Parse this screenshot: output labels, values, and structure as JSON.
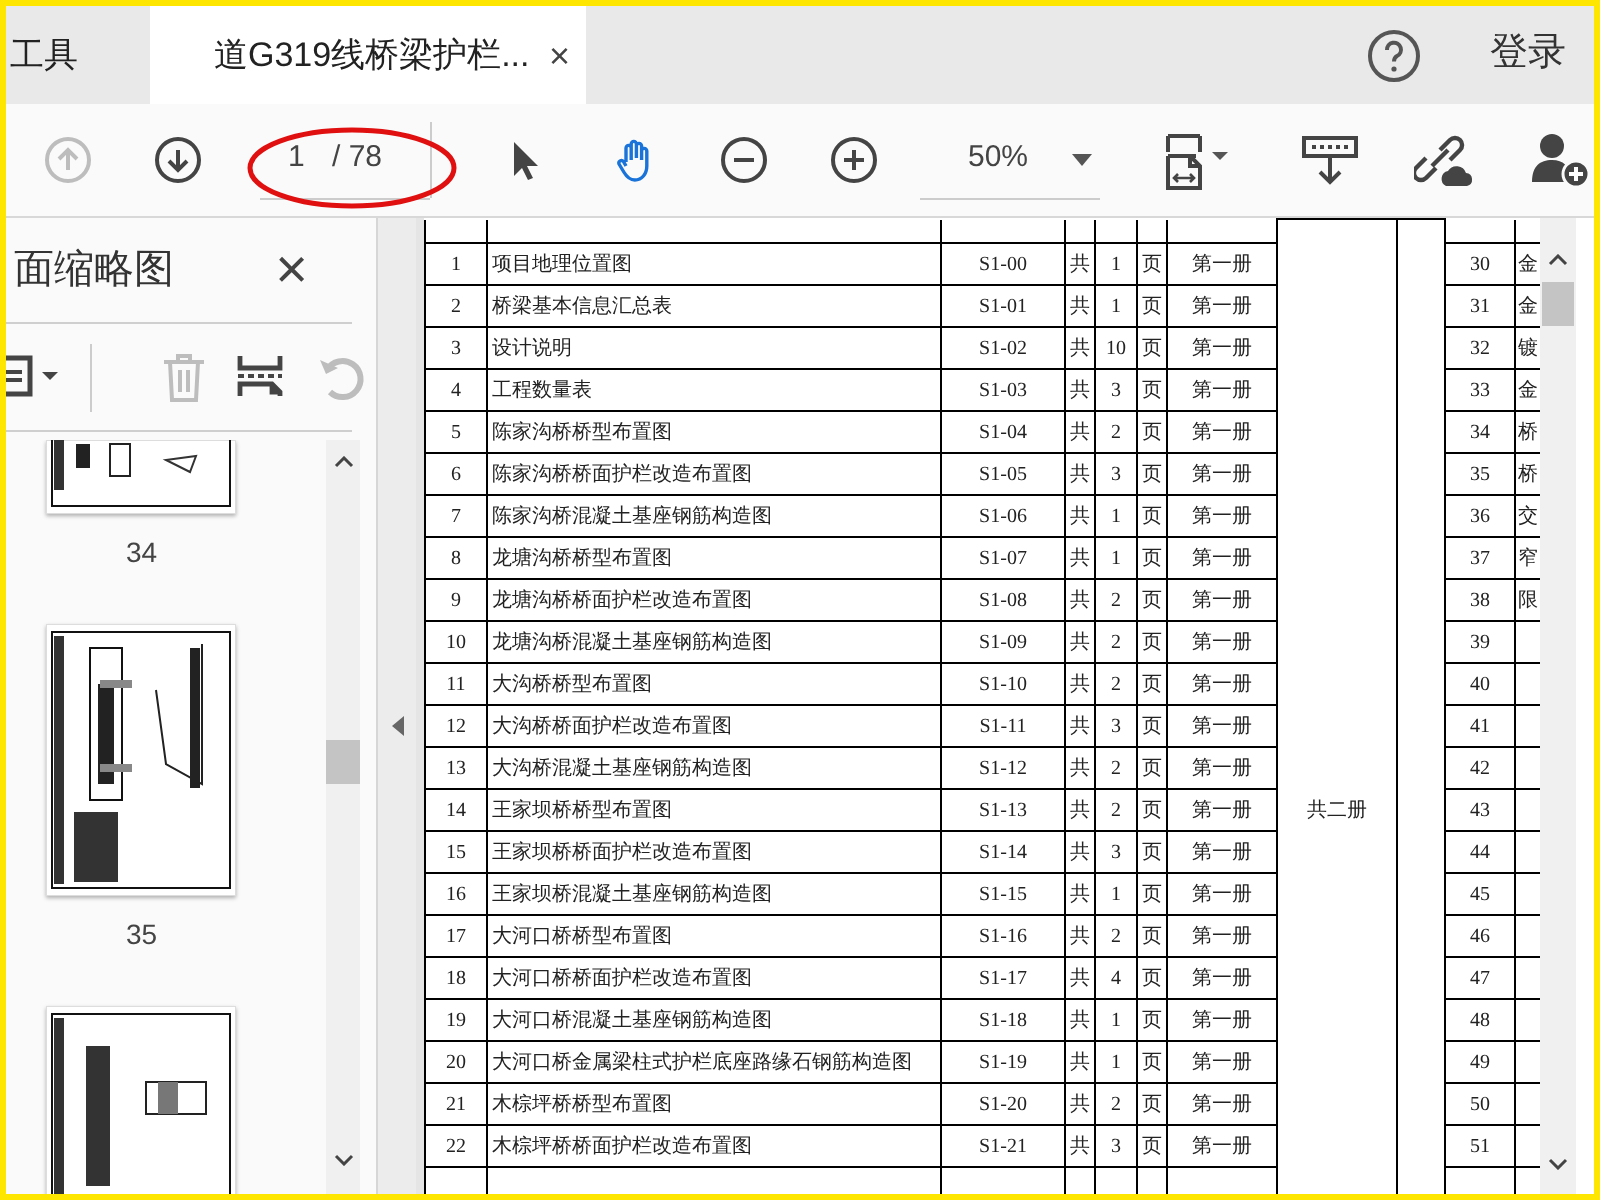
{
  "tabs": [
    {
      "label": "工具",
      "selected": false
    },
    {
      "label": "道G319线桥梁护栏...",
      "selected": true,
      "close": "×"
    }
  ],
  "header_right": {
    "login": "登录"
  },
  "toolbar": {
    "nav": [
      {
        "kind": "prev-page",
        "disabled": true
      },
      {
        "kind": "next-page",
        "disabled": false
      }
    ],
    "page_field": {
      "value": "1"
    },
    "page_count": "/ 78",
    "tools": [
      {
        "kind": "select",
        "selected": false
      },
      {
        "kind": "hand",
        "selected": true
      }
    ],
    "zoom": "50%"
  },
  "sidebar": {
    "title": "面缩略图",
    "close": "×",
    "tools": [
      {
        "kind": "options",
        "disabled": false
      },
      {
        "kind": "delete",
        "disabled": true
      },
      {
        "kind": "extract",
        "disabled": false
      },
      {
        "kind": "rotate",
        "disabled": true
      }
    ],
    "thumbnails": [
      {
        "label": "34"
      },
      {
        "label": "35"
      }
    ]
  },
  "table": {
    "merged_volume": "共二册",
    "rows": [
      {
        "no": "1",
        "name": "项目地理位置图",
        "code": "S1-00",
        "total": "共",
        "count": "1",
        "unit": "页",
        "volume": "第一册"
      },
      {
        "no": "2",
        "name": "桥梁基本信息汇总表",
        "code": "S1-01",
        "total": "共",
        "count": "1",
        "unit": "页",
        "volume": "第一册"
      },
      {
        "no": "3",
        "name": "设计说明",
        "code": "S1-02",
        "total": "共",
        "count": "10",
        "unit": "页",
        "volume": "第一册"
      },
      {
        "no": "4",
        "name": "工程数量表",
        "code": "S1-03",
        "total": "共",
        "count": "3",
        "unit": "页",
        "volume": "第一册"
      },
      {
        "no": "5",
        "name": "陈家沟桥桥型布置图",
        "code": "S1-04",
        "total": "共",
        "count": "2",
        "unit": "页",
        "volume": "第一册"
      },
      {
        "no": "6",
        "name": "陈家沟桥桥面护栏改造布置图",
        "code": "S1-05",
        "total": "共",
        "count": "3",
        "unit": "页",
        "volume": "第一册"
      },
      {
        "no": "7",
        "name": "陈家沟桥混凝土基座钢筋构造图",
        "code": "S1-06",
        "total": "共",
        "count": "1",
        "unit": "页",
        "volume": "第一册"
      },
      {
        "no": "8",
        "name": "龙塘沟桥桥型布置图",
        "code": "S1-07",
        "total": "共",
        "count": "1",
        "unit": "页",
        "volume": "第一册"
      },
      {
        "no": "9",
        "name": "龙塘沟桥桥面护栏改造布置图",
        "code": "S1-08",
        "total": "共",
        "count": "2",
        "unit": "页",
        "volume": "第一册"
      },
      {
        "no": "10",
        "name": "龙塘沟桥混凝土基座钢筋构造图",
        "code": "S1-09",
        "total": "共",
        "count": "2",
        "unit": "页",
        "volume": "第一册"
      },
      {
        "no": "11",
        "name": "大沟桥桥型布置图",
        "code": "S1-10",
        "total": "共",
        "count": "2",
        "unit": "页",
        "volume": "第一册"
      },
      {
        "no": "12",
        "name": "大沟桥桥面护栏改造布置图",
        "code": "S1-11",
        "total": "共",
        "count": "3",
        "unit": "页",
        "volume": "第一册"
      },
      {
        "no": "13",
        "name": "大沟桥混凝土基座钢筋构造图",
        "code": "S1-12",
        "total": "共",
        "count": "2",
        "unit": "页",
        "volume": "第一册"
      },
      {
        "no": "14",
        "name": "王家坝桥桥型布置图",
        "code": "S1-13",
        "total": "共",
        "count": "2",
        "unit": "页",
        "volume": "第一册"
      },
      {
        "no": "15",
        "name": "王家坝桥桥面护栏改造布置图",
        "code": "S1-14",
        "total": "共",
        "count": "3",
        "unit": "页",
        "volume": "第一册"
      },
      {
        "no": "16",
        "name": "王家坝桥混凝土基座钢筋构造图",
        "code": "S1-15",
        "total": "共",
        "count": "1",
        "unit": "页",
        "volume": "第一册"
      },
      {
        "no": "17",
        "name": "大河口桥桥型布置图",
        "code": "S1-16",
        "total": "共",
        "count": "2",
        "unit": "页",
        "volume": "第一册"
      },
      {
        "no": "18",
        "name": "大河口桥桥面护栏改造布置图",
        "code": "S1-17",
        "total": "共",
        "count": "4",
        "unit": "页",
        "volume": "第一册"
      },
      {
        "no": "19",
        "name": "大河口桥混凝土基座钢筋构造图",
        "code": "S1-18",
        "total": "共",
        "count": "1",
        "unit": "页",
        "volume": "第一册"
      },
      {
        "no": "20",
        "name": "大河口桥金属梁柱式护栏底座路缘石钢筋构造图",
        "code": "S1-19",
        "total": "共",
        "count": "1",
        "unit": "页",
        "volume": "第一册"
      },
      {
        "no": "21",
        "name": "木棕坪桥桥型布置图",
        "code": "S1-20",
        "total": "共",
        "count": "2",
        "unit": "页",
        "volume": "第一册"
      },
      {
        "no": "22",
        "name": "木棕坪桥桥面护栏改造布置图",
        "code": "S1-21",
        "total": "共",
        "count": "3",
        "unit": "页",
        "volume": "第一册"
      }
    ],
    "right_rows": [
      {
        "no": "30",
        "text": "金"
      },
      {
        "no": "31",
        "text": "金"
      },
      {
        "no": "32",
        "text": "镀"
      },
      {
        "no": "33",
        "text": "金"
      },
      {
        "no": "34",
        "text": "桥"
      },
      {
        "no": "35",
        "text": "桥"
      },
      {
        "no": "36",
        "text": "交"
      },
      {
        "no": "37",
        "text": "窄"
      },
      {
        "no": "38",
        "text": "限"
      },
      {
        "no": "39"
      },
      {
        "no": "40"
      },
      {
        "no": "41"
      },
      {
        "no": "42"
      },
      {
        "no": "43"
      },
      {
        "no": "44"
      },
      {
        "no": "45"
      },
      {
        "no": "46"
      },
      {
        "no": "47"
      },
      {
        "no": "48"
      },
      {
        "no": "49"
      },
      {
        "no": "50"
      },
      {
        "no": "51"
      }
    ]
  }
}
